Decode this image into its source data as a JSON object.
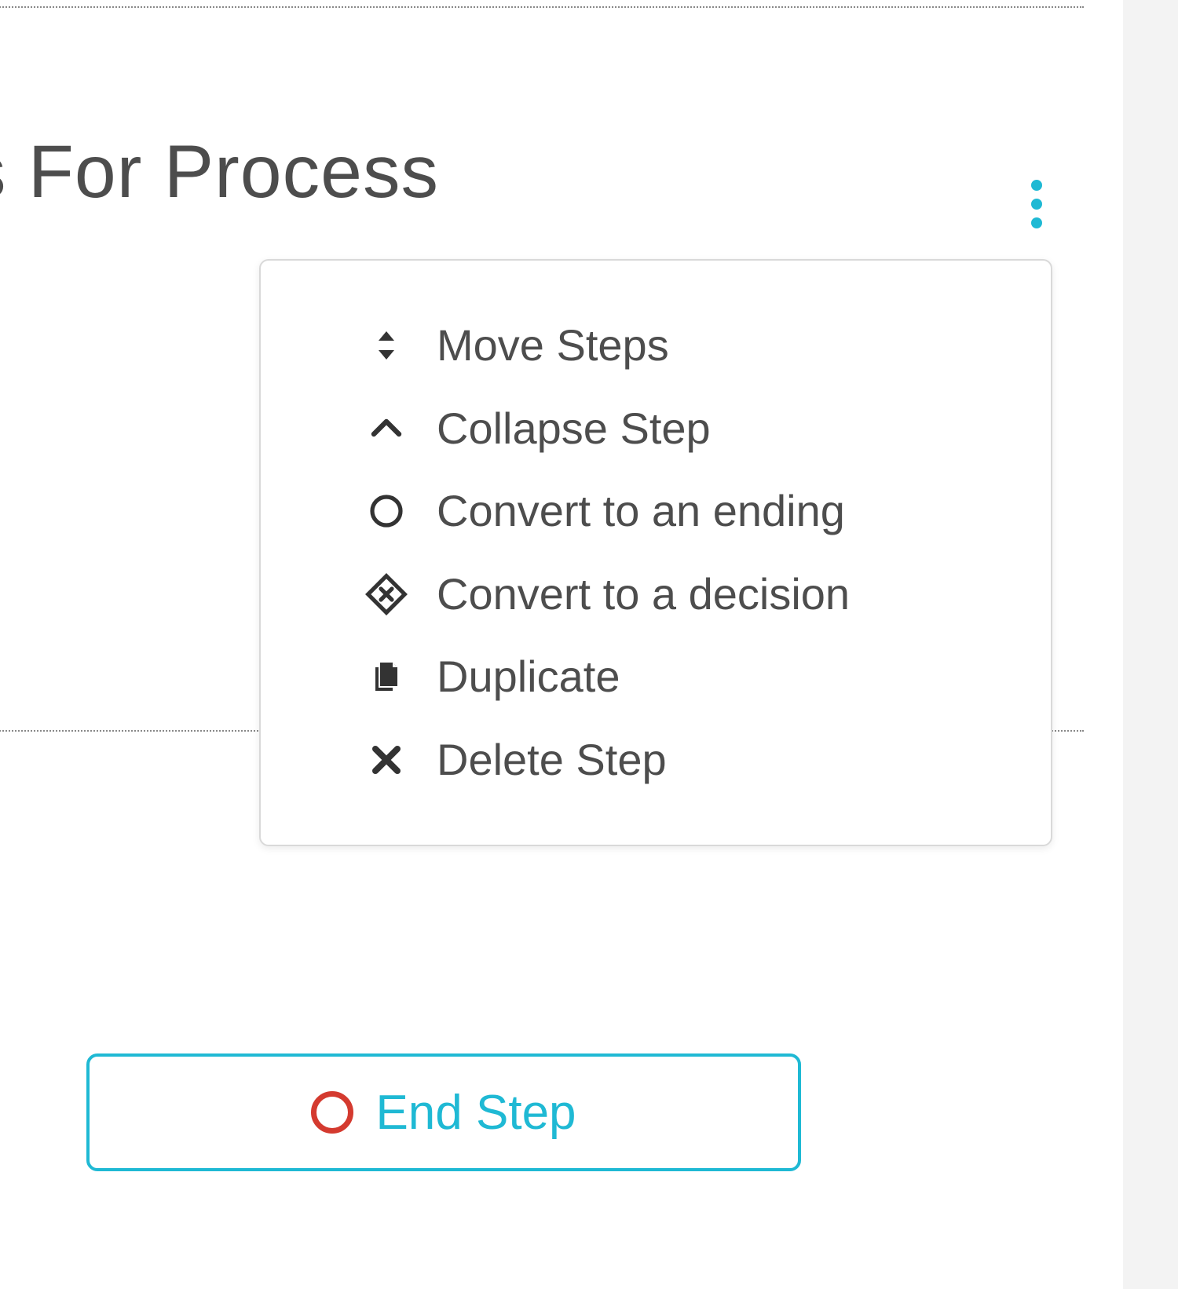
{
  "card": {
    "title_fragment": "s For Process"
  },
  "menu": {
    "items": [
      {
        "id": "move",
        "label": "Move Steps",
        "icon": "sort-icon"
      },
      {
        "id": "collapse",
        "label": "Collapse Step",
        "icon": "chevron-up-icon"
      },
      {
        "id": "ending",
        "label": "Convert to an ending",
        "icon": "circle-outline-icon"
      },
      {
        "id": "decision",
        "label": "Convert to a decision",
        "icon": "diamond-x-icon"
      },
      {
        "id": "dup",
        "label": "Duplicate",
        "icon": "copy-icon"
      },
      {
        "id": "delete",
        "label": "Delete Step",
        "icon": "x-icon"
      }
    ]
  },
  "end_step": {
    "label": "End Step"
  },
  "colors": {
    "accent": "#1fb9d4",
    "danger": "#d43a2f",
    "text": "#4d4d4d"
  }
}
